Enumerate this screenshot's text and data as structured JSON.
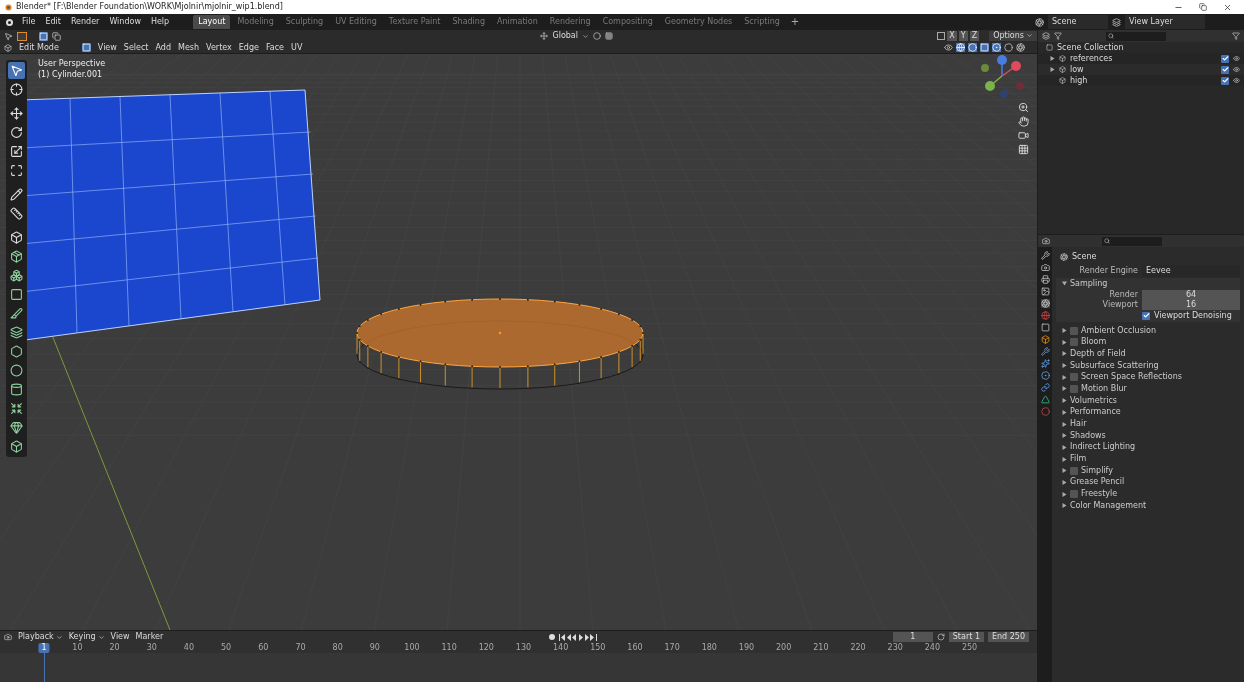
{
  "title_bar": {
    "title": "Blender* [F:\\Blender Foundation\\WORK\\Mjolnir\\mjolnir_wip1.blend]"
  },
  "menu_bar": {
    "menus": [
      "File",
      "Edit",
      "Render",
      "Window",
      "Help"
    ],
    "workspaces": [
      {
        "label": "Layout",
        "selected": true
      },
      {
        "label": "Modeling",
        "selected": false
      },
      {
        "label": "Sculpting",
        "selected": false
      },
      {
        "label": "UV Editing",
        "selected": false
      },
      {
        "label": "Texture Paint",
        "selected": false
      },
      {
        "label": "Shading",
        "selected": false
      },
      {
        "label": "Animation",
        "selected": false
      },
      {
        "label": "Rendering",
        "selected": false
      },
      {
        "label": "Compositing",
        "selected": false
      },
      {
        "label": "Geometry Nodes",
        "selected": false
      },
      {
        "label": "Scripting",
        "selected": false
      }
    ],
    "add_workspace": "+",
    "scene": "Scene",
    "view_layer": "View Layer"
  },
  "viewport": {
    "transform_orientation": "Global",
    "axes": [
      "X",
      "Y",
      "Z"
    ],
    "options": "Options",
    "mode": "Edit Mode",
    "menus": [
      "View",
      "Select",
      "Add",
      "Mesh",
      "Vertex",
      "Edge",
      "Face",
      "UV"
    ],
    "overlay": {
      "view": "User Perspective",
      "object": "(1) Cylinder.001"
    }
  },
  "outliner": {
    "root": "Scene Collection",
    "items": [
      {
        "name": "references",
        "expanded": false,
        "checked": true
      },
      {
        "name": "low",
        "expanded": false,
        "checked": true
      },
      {
        "name": "high",
        "checked": true
      }
    ]
  },
  "properties": {
    "context": "Scene",
    "render_engine_label": "Render Engine",
    "render_engine": "Eevee",
    "sections": [
      {
        "label": "Sampling",
        "expanded": true,
        "fields": [
          {
            "label": "Render",
            "value": "64"
          },
          {
            "label": "Viewport",
            "value": "16"
          }
        ],
        "option": {
          "label": "Viewport Denoising",
          "checked": true
        }
      },
      {
        "label": "Ambient Occlusion",
        "expanded": false,
        "checked": false
      },
      {
        "label": "Bloom",
        "expanded": false,
        "checked": false
      },
      {
        "label": "Depth of Field",
        "expanded": false
      },
      {
        "label": "Subsurface Scattering",
        "expanded": false
      },
      {
        "label": "Screen Space Reflections",
        "expanded": false,
        "checked": false
      },
      {
        "label": "Motion Blur",
        "expanded": false,
        "checked": false
      },
      {
        "label": "Volumetrics",
        "expanded": false
      },
      {
        "label": "Performance",
        "expanded": false
      },
      {
        "label": "Hair",
        "expanded": false
      },
      {
        "label": "Shadows",
        "expanded": false
      },
      {
        "label": "Indirect Lighting",
        "expanded": false
      },
      {
        "label": "Film",
        "expanded": false
      },
      {
        "label": "Simplify",
        "expanded": false,
        "checked": false
      },
      {
        "label": "Grease Pencil",
        "expanded": false
      },
      {
        "label": "Freestyle",
        "expanded": false,
        "checked": false
      },
      {
        "label": "Color Management",
        "expanded": false
      }
    ]
  },
  "timeline": {
    "menus": [
      "Playback",
      "Keying",
      "View",
      "Marker"
    ],
    "current_frame": "1",
    "start_label": "Start",
    "start": "1",
    "end_label": "End",
    "end": "250",
    "playhead": "1",
    "ruler": [
      "10",
      "20",
      "30",
      "40",
      "50",
      "60",
      "70",
      "80",
      "90",
      "100",
      "110",
      "120",
      "130",
      "140",
      "150",
      "160",
      "170",
      "180",
      "190",
      "200",
      "210",
      "220",
      "230",
      "240",
      "250"
    ]
  }
}
